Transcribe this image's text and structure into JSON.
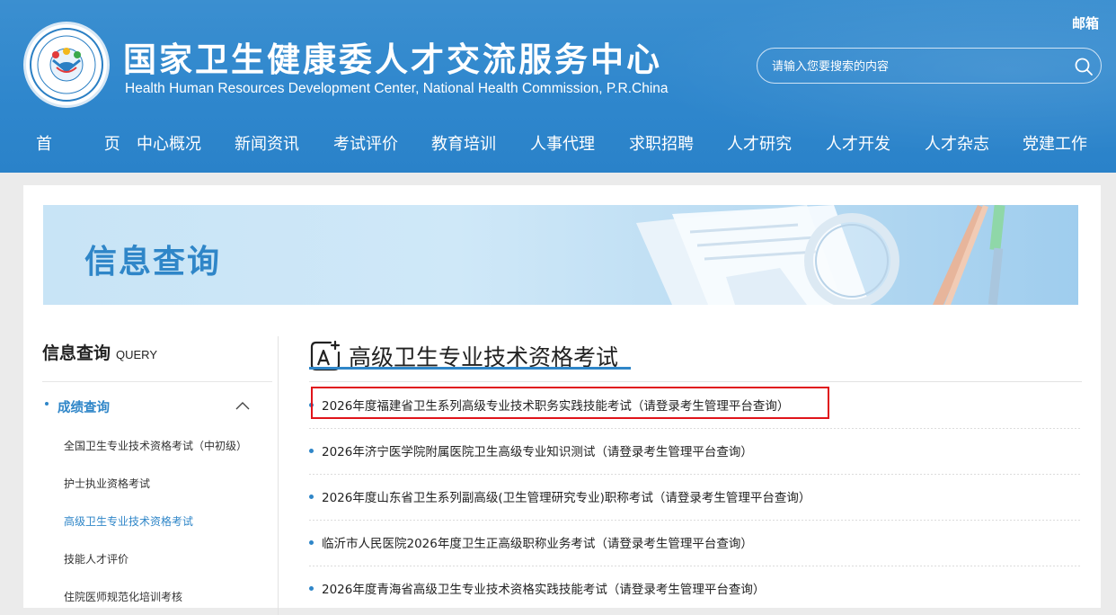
{
  "header": {
    "cn_title": "国家卫生健康委人才交流服务中心",
    "en_title": "Health Human Resources Development Center, National Health Commission, P.R.China",
    "mail_label": "邮箱",
    "search": {
      "placeholder": "请输入您要搜索的内容",
      "value": ""
    },
    "logo_icon": "organization-seal-logo"
  },
  "nav": {
    "items": [
      {
        "label": "首 页"
      },
      {
        "label": "中心概况"
      },
      {
        "label": "新闻资讯"
      },
      {
        "label": "考试评价"
      },
      {
        "label": "教育培训"
      },
      {
        "label": "人事代理"
      },
      {
        "label": "求职招聘"
      },
      {
        "label": "人才研究"
      },
      {
        "label": "人才开发"
      },
      {
        "label": "人才杂志"
      },
      {
        "label": "党建工作"
      }
    ]
  },
  "banner": {
    "title": "信息查询"
  },
  "sidebar": {
    "title": "信息查询",
    "title_en": "QUERY",
    "category": {
      "label": "成绩查询",
      "expanded": true
    },
    "items": [
      {
        "label": "全国卫生专业技术资格考试（中初级）",
        "active": false
      },
      {
        "label": "护士执业资格考试",
        "active": false
      },
      {
        "label": "高级卫生专业技术资格考试",
        "active": true
      },
      {
        "label": "技能人才评价",
        "active": false
      },
      {
        "label": "住院医师规范化培训考核",
        "active": false
      }
    ]
  },
  "content": {
    "title": "高级卫生专业技术资格考试",
    "icon": "ai-text-icon",
    "items": [
      {
        "text": "2026年度福建省卫生系列高级专业技术职务实践技能考试（请登录考生管理平台查询）",
        "highlighted": true
      },
      {
        "text": "2026年济宁医学院附属医院卫生高级专业知识测试（请登录考生管理平台查询）"
      },
      {
        "text": "2026年度山东省卫生系列副高级(卫生管理研究专业)职称考试（请登录考生管理平台查询）"
      },
      {
        "text": "临沂市人民医院2026年度卫生正高级职称业务考试（请登录考生管理平台查询）"
      },
      {
        "text": "2026年度青海省高级卫生专业技术资格实践技能考试（请登录考生管理平台查询）"
      }
    ]
  },
  "colors": {
    "header_blue": "#2f87cd",
    "accent_blue": "#2f86c8",
    "highlight_red": "#e0141a"
  }
}
